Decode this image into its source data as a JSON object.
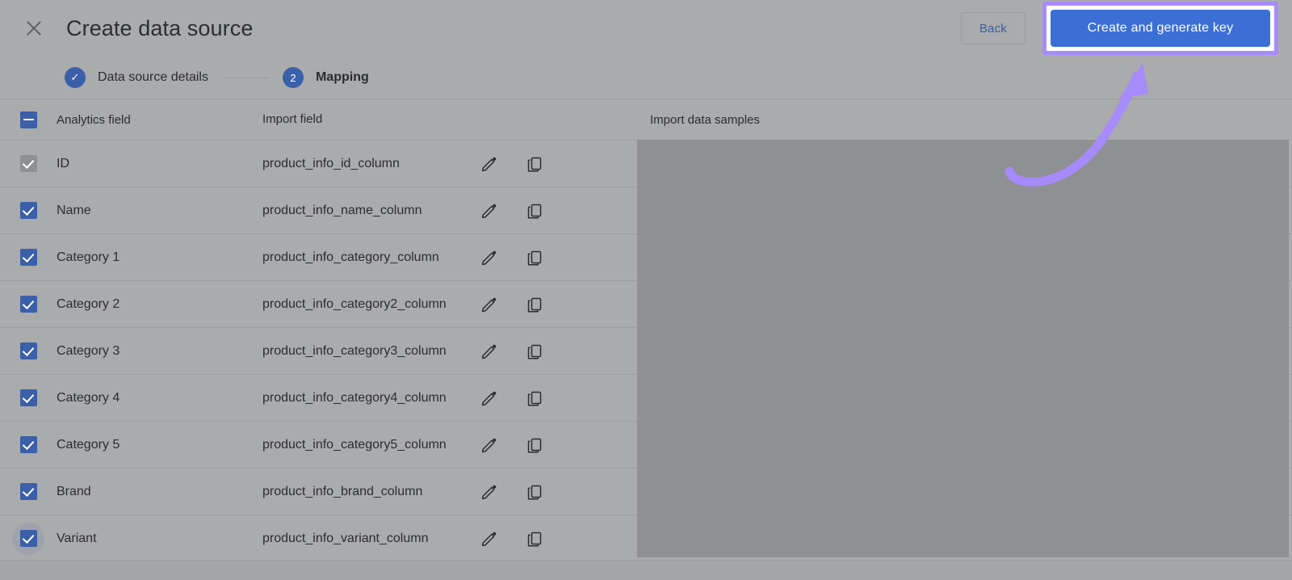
{
  "appbar": {
    "close_icon": "close-icon",
    "title": "Create data source",
    "back_label": "Back",
    "cta_label": "Create and generate key"
  },
  "stepper": {
    "steps": [
      {
        "marker": "✓",
        "label": "Data source details",
        "state": "completed"
      },
      {
        "marker": "2",
        "label": "Mapping",
        "state": "current"
      }
    ]
  },
  "table": {
    "headers": {
      "analytics_field": "Analytics field",
      "import_field": "Import field",
      "import_data_samples": "Import data samples"
    },
    "select_all_state": "indeterminate",
    "row_action_icons": [
      "edit-pencil-icon",
      "copy-icon"
    ],
    "rows": [
      {
        "analytics_field": "ID",
        "import_field": "product_info_id_column",
        "checked": true,
        "disabled": true,
        "focused": false
      },
      {
        "analytics_field": "Name",
        "import_field": "product_info_name_column",
        "checked": true,
        "disabled": false,
        "focused": false
      },
      {
        "analytics_field": "Category 1",
        "import_field": "product_info_category_column",
        "checked": true,
        "disabled": false,
        "focused": false
      },
      {
        "analytics_field": "Category 2",
        "import_field": "product_info_category2_column",
        "checked": true,
        "disabled": false,
        "focused": false
      },
      {
        "analytics_field": "Category 3",
        "import_field": "product_info_category3_column",
        "checked": true,
        "disabled": false,
        "focused": false
      },
      {
        "analytics_field": "Category 4",
        "import_field": "product_info_category4_column",
        "checked": true,
        "disabled": false,
        "focused": false
      },
      {
        "analytics_field": "Category 5",
        "import_field": "product_info_category5_column",
        "checked": true,
        "disabled": false,
        "focused": false
      },
      {
        "analytics_field": "Brand",
        "import_field": "product_info_brand_column",
        "checked": true,
        "disabled": false,
        "focused": false
      },
      {
        "analytics_field": "Variant",
        "import_field": "product_info_variant_column",
        "checked": true,
        "disabled": false,
        "focused": true
      }
    ]
  },
  "annotation": {
    "highlight_color": "#a78bfa",
    "arrow_name": "curved-arrow-annotation",
    "target": "Create and generate key"
  },
  "colors": {
    "accent_blue": "#3b5fa8",
    "cta_blue": "#3c6fd6",
    "page_bg": "#aaabad",
    "panel_bg": "#8e9093",
    "divider": "#9c9da0",
    "highlight_purple": "#a78bfa"
  }
}
